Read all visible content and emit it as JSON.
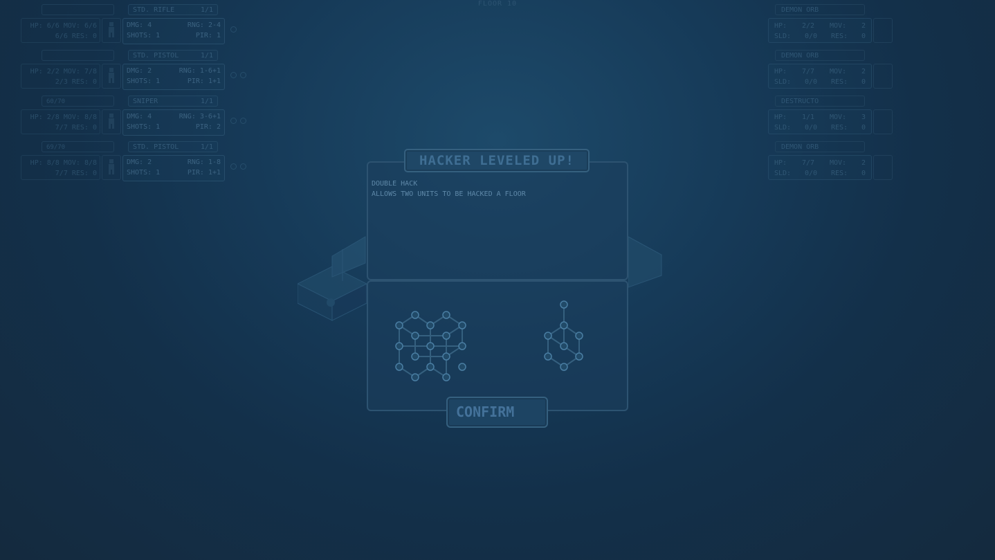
{
  "floor_label": "FLOOR 10",
  "left_units": [
    {
      "name": "",
      "stat1": "HP: 6/6 MOV: 6/6",
      "stat2": "6/6 RES: 0",
      "weapon": "STD. RIFLE",
      "weapon_count": "1/1",
      "dmg": "4",
      "rng": "2-4",
      "shots": "1",
      "pir": "1"
    },
    {
      "name": "",
      "stat1": "HP: 2/2 MOV: 7/8",
      "stat2": "2/3 RES: 0",
      "weapon": "STD. PISTOL",
      "weapon_count": "1/1",
      "dmg": "2",
      "rng": "1-6+1",
      "shots": "1",
      "pir": "1+1"
    },
    {
      "name": "60/70",
      "stat1": "HP: 2/8 MOV: 8/8",
      "stat2": "7/7 RES: 0",
      "weapon": "SNIPER",
      "weapon_count": "1/1",
      "dmg": "4",
      "rng": "3-6+1",
      "shots": "1",
      "pir": "2"
    },
    {
      "name": "69/70",
      "stat1": "HP: 8/8 MOV: 8/8",
      "stat2": "7/7 RES: 0",
      "weapon": "STD. PISTOL",
      "weapon_count": "1/1",
      "dmg": "2",
      "rng": "1-8",
      "shots": "1",
      "pir": "1+1"
    }
  ],
  "labels": {
    "dmg": "DMG:",
    "rng": "RNG:",
    "shots": "SHOTS:",
    "pir": "PIR:",
    "hp": "HP:",
    "mov": "MOV:",
    "sld": "SLD:",
    "res": "RES:"
  },
  "right_units": [
    {
      "name": "DEMON ORB",
      "hp": "2/2",
      "mov": "2",
      "sld": "0/0",
      "res": "0"
    },
    {
      "name": "DEMON ORB",
      "hp": "7/7",
      "mov": "2",
      "sld": "0/0",
      "res": "0"
    },
    {
      "name": "DESTRUCTO",
      "hp": "1/1",
      "mov": "3",
      "sld": "0/0",
      "res": "0"
    },
    {
      "name": "DEMON ORB",
      "hp": "7/7",
      "mov": "2",
      "sld": "0/0",
      "res": "0"
    }
  ],
  "modal": {
    "title": "HACKER LEVELED UP!",
    "ability_name": "DOUBLE HACK",
    "ability_desc": "ALLOWS TWO UNITS TO BE HACKED A FLOOR",
    "confirm_label": "CONFIRM"
  }
}
